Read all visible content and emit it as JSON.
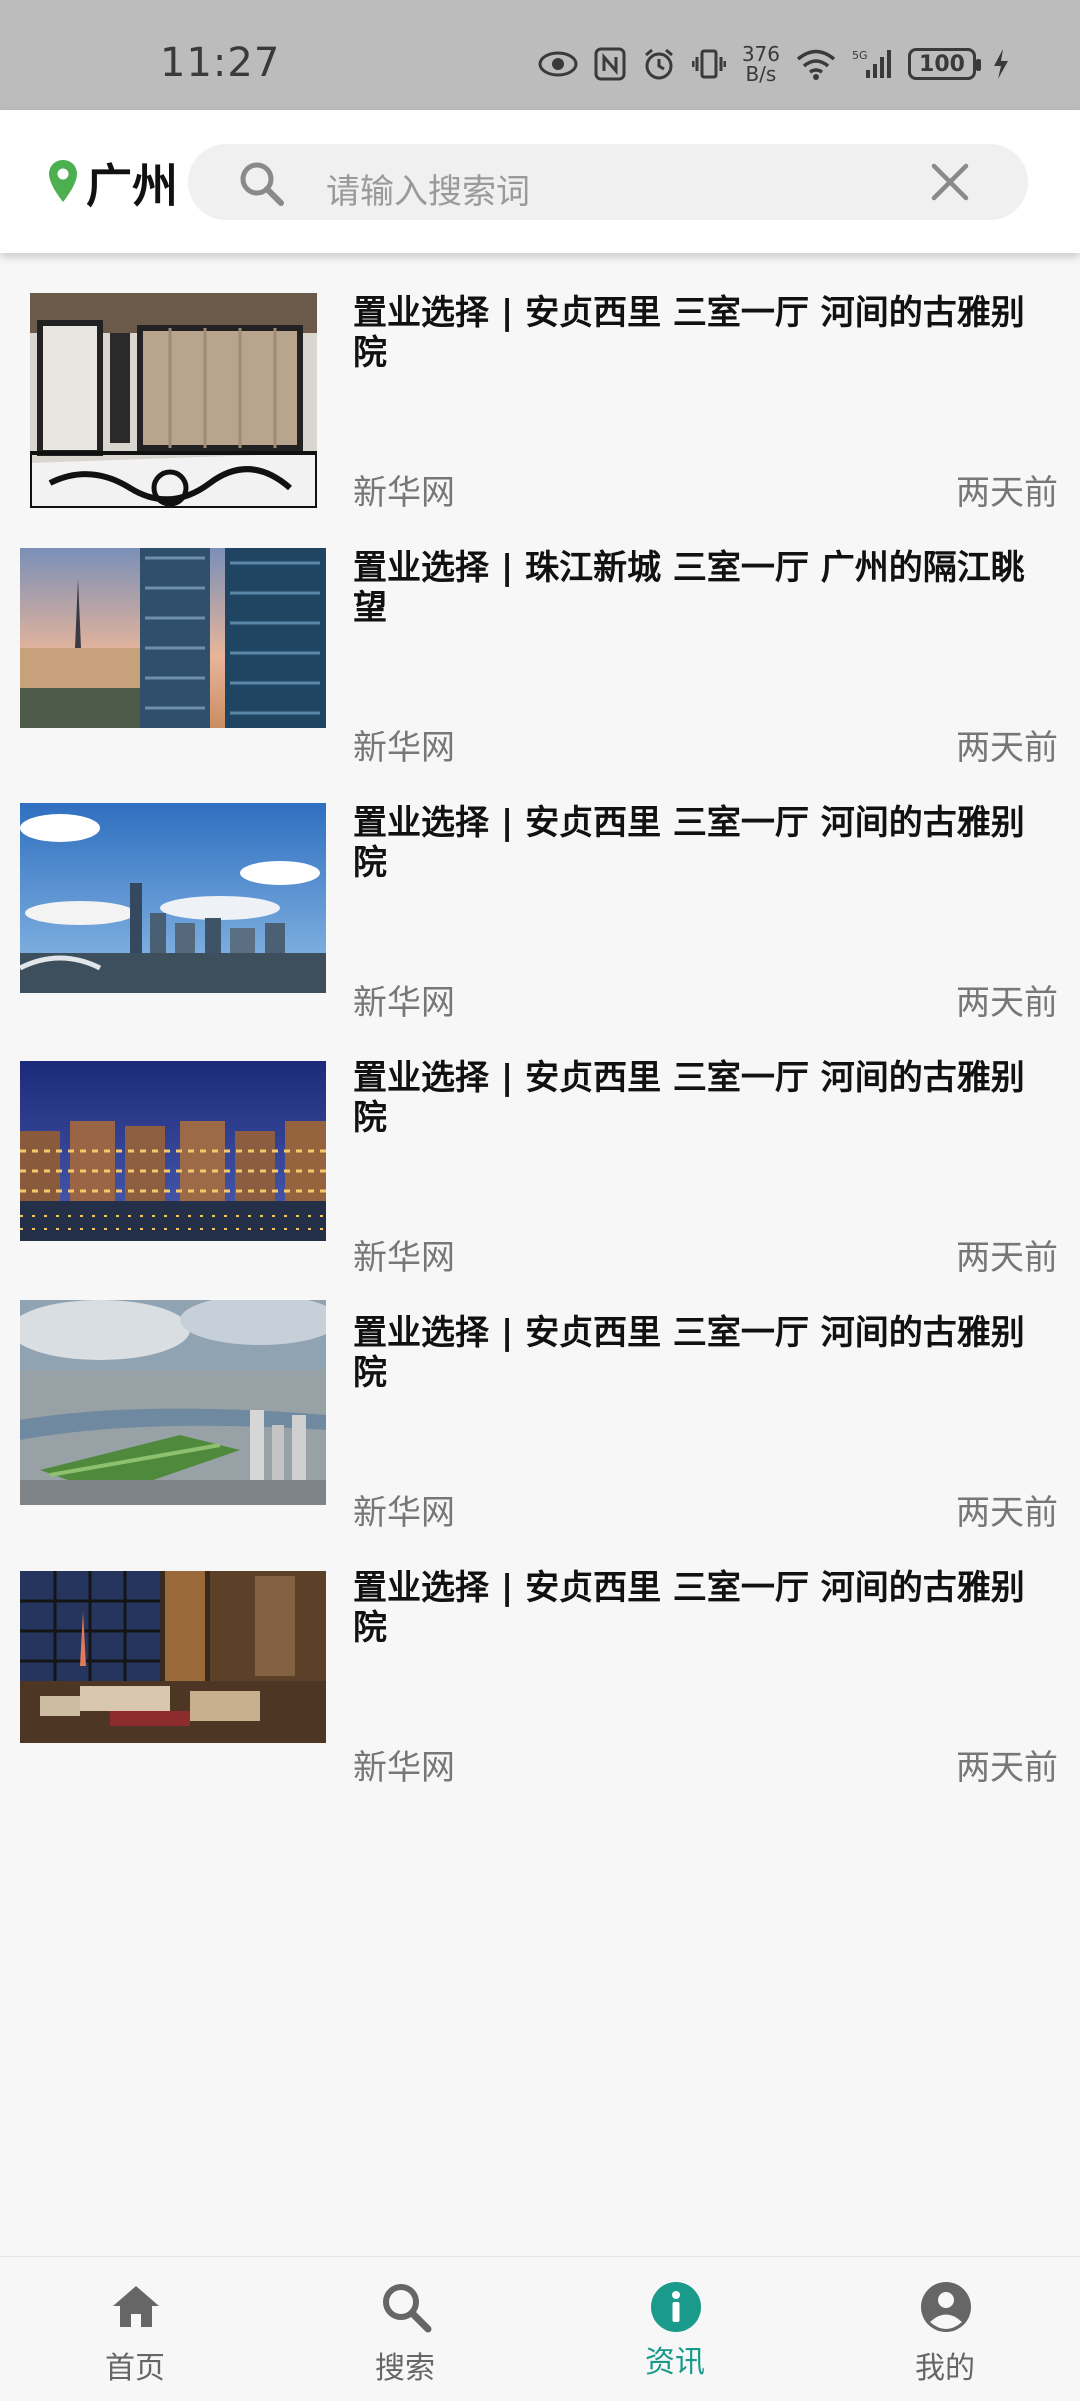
{
  "status_bar": {
    "time": "11:27",
    "net_speed_top": "376",
    "net_speed_bottom": "B/s",
    "battery": "100",
    "icons": [
      "eye-icon",
      "nfc-icon",
      "alarm-icon",
      "vibrate-icon",
      "wifi-icon",
      "signal-icon",
      "charging-icon"
    ]
  },
  "header": {
    "city": "广州",
    "search_placeholder": "请输入搜索词",
    "accent_color": "#4caf50"
  },
  "news": [
    {
      "title": "置业选择 | 安贞西里 三室一厅 河间的古雅别院",
      "source": "新华网",
      "time": "两天前",
      "image": "luxury-interior"
    },
    {
      "title": "置业选择 | 珠江新城 三室一厅 广州的隔江眺望",
      "source": "新华网",
      "time": "两天前",
      "image": "city-towers-sunset"
    },
    {
      "title": "置业选择 | 安贞西里 三室一厅 河间的古雅别院",
      "source": "新华网",
      "time": "两天前",
      "image": "skyline-blue-sky"
    },
    {
      "title": "置业选择 | 安贞西里 三室一厅 河间的古雅别院",
      "source": "新华网",
      "time": "两天前",
      "image": "night-residences"
    },
    {
      "title": "置业选择 | 安贞西里 三室一厅 河间的古雅别院",
      "source": "新华网",
      "time": "两天前",
      "image": "aerial-river-city"
    },
    {
      "title": "置业选择 | 安贞西里 三室一厅 河间的古雅别院",
      "source": "新华网",
      "time": "两天前",
      "image": "living-room-view"
    }
  ],
  "bottom_nav": {
    "active_color": "#1a9a8b",
    "items": [
      {
        "label": "首页",
        "icon": "home-icon"
      },
      {
        "label": "搜索",
        "icon": "search-icon"
      },
      {
        "label": "资讯",
        "icon": "info-icon"
      },
      {
        "label": "我的",
        "icon": "account-icon"
      }
    ]
  }
}
